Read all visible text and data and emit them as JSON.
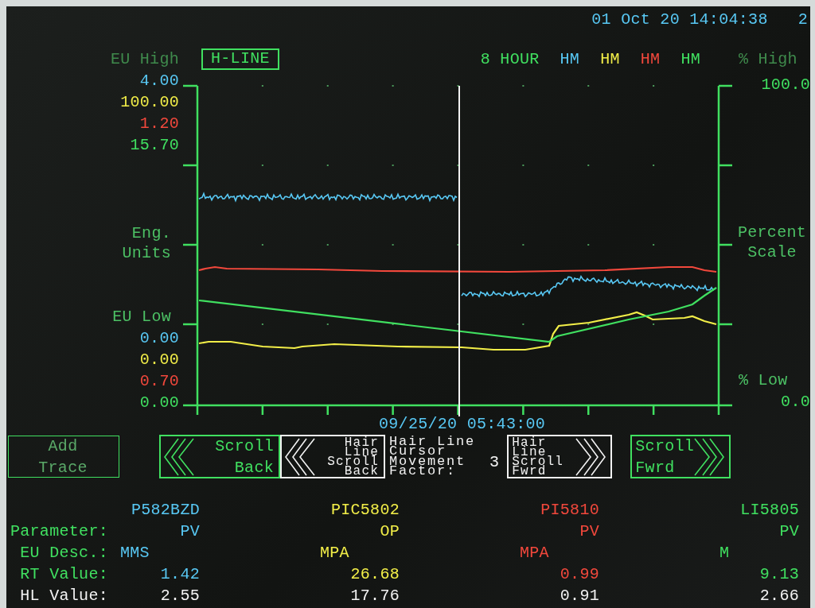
{
  "header": {
    "timestamp": "01 Oct 20 14:04:38",
    "page": "2"
  },
  "trend": {
    "eu_high_label": "EU High",
    "hairline_button": "H-LINE",
    "time_span": "8 HOUR",
    "percent_high_label": "% High",
    "percent_high": "100.0",
    "left_scale_label": "Eng. Units",
    "right_scale_label": "Percent Scale",
    "eu_low_label": "EU Low",
    "percent_low_label": "% Low",
    "percent_low": "0.0",
    "cursor_time": "09/25/20 05:43:00"
  },
  "traces": [
    {
      "color": "#58c8f4",
      "mode": "HM",
      "eu_high": "4.00",
      "eu_low": "0.00",
      "tag": "P582BZD",
      "parameter": "PV",
      "eu_desc": "MMS",
      "rt_value": "1.42",
      "hl_value": "2.55"
    },
    {
      "color": "#f2ee48",
      "mode": "HM",
      "eu_high": "100.00",
      "eu_low": "0.00",
      "tag": "PIC5802",
      "parameter": "OP",
      "eu_desc": "MPA",
      "rt_value": "26.68",
      "hl_value": "17.76"
    },
    {
      "color": "#f2483c",
      "mode": "HM",
      "eu_high": "1.20",
      "eu_low": "0.70",
      "tag": "PI5810",
      "parameter": "PV",
      "eu_desc": "MPA",
      "rt_value": "0.99",
      "hl_value": "0.91"
    },
    {
      "color": "#40e060",
      "mode": "HM",
      "eu_high": "15.70",
      "eu_low": "0.00",
      "tag": "LI5805",
      "parameter": "PV",
      "eu_desc": "M",
      "rt_value": "9.13",
      "hl_value": "2.66"
    }
  ],
  "controls": [
    {
      "kind": "add",
      "label": "Add Trace"
    },
    {
      "kind": "scrollback",
      "label": "Scroll Back"
    },
    {
      "kind": "hairlineback",
      "label": "Hair Line Scroll Back"
    },
    {
      "kind": "factor",
      "label": "Hair Line Cursor Movement Factor:",
      "value": "3"
    },
    {
      "kind": "hairlinefwd",
      "label": "Hair Line Scroll Fwrd"
    },
    {
      "kind": "scrollfwd",
      "label": "Scroll Fwrd"
    }
  ],
  "table": {
    "row_labels": [
      {
        "text": "Parameter:",
        "color": "#40e060"
      },
      {
        "text": "EU Desc.:",
        "color": "#40e060"
      },
      {
        "text": "RT Value:",
        "color": "#40e060"
      },
      {
        "text": "HL Value:",
        "color": "#f2f2f2"
      }
    ]
  }
}
